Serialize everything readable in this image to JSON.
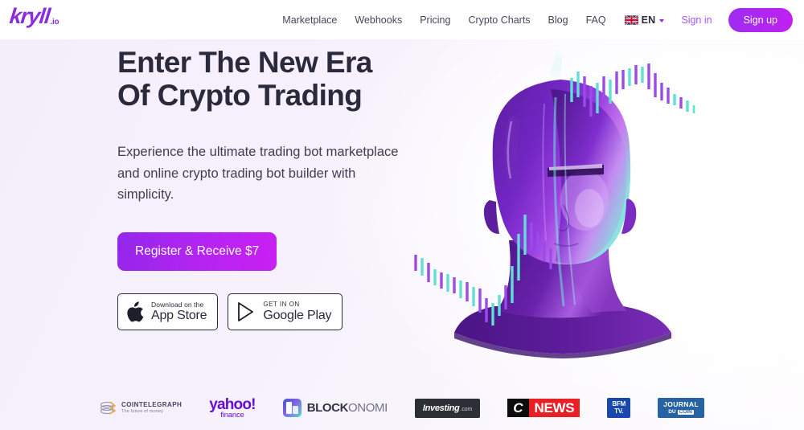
{
  "brand": {
    "logo_main": "kryll",
    "logo_suffix": ".io",
    "accent_purple": "#8a2be2",
    "accent_magenta": "#c31ff0"
  },
  "header": {
    "nav_items": [
      {
        "label": "Marketplace",
        "name": "nav-marketplace"
      },
      {
        "label": "Webhooks",
        "name": "nav-webhooks"
      },
      {
        "label": "Pricing",
        "name": "nav-pricing"
      },
      {
        "label": "Crypto Charts",
        "name": "nav-crypto-charts"
      },
      {
        "label": "Blog",
        "name": "nav-blog"
      },
      {
        "label": "FAQ",
        "name": "nav-faq"
      }
    ],
    "language": {
      "label": "EN",
      "flag": "uk-flag-icon",
      "caret": "chevron-down-icon"
    },
    "sign_in_label": "Sign in",
    "sign_up_label": "Sign up"
  },
  "hero": {
    "headline": "Enter The New Era Of Crypto Trading",
    "subtitle": "Experience the ultimate trading bot marketplace and online crypto trading bot builder with simplicity.",
    "cta_label": "Register & Receive $7",
    "headline_color": "#2b2a3d",
    "background_color": "#f6f1fc",
    "app_store": {
      "top": "Download on the",
      "bottom": "App Store",
      "icon": "apple-icon"
    },
    "google_play": {
      "top": "GET IN ON",
      "bottom": "Google Play",
      "icon": "google-play-icon"
    },
    "illustration": {
      "name": "crypto-ai-head-illustration",
      "description": "Purple 3D android head with candlestick charts"
    }
  },
  "press": [
    {
      "name": "cointelegraph",
      "title": "COINTELEGRAPH",
      "tagline": "The future of money"
    },
    {
      "name": "yahoo-finance",
      "title": "yahoo!",
      "tagline": "finance"
    },
    {
      "name": "blockonomi",
      "title_bold": "BLOCK",
      "title_light": "ONOMI"
    },
    {
      "name": "investing-com",
      "title": "Investing",
      "suffix": ".com"
    },
    {
      "name": "cnews",
      "letter": "C",
      "title": "NEWS"
    },
    {
      "name": "bfm-tv",
      "line1": "BFM",
      "line2": "TV."
    },
    {
      "name": "journal-du-coin",
      "line1": "JOURNAL",
      "line2_a": "DU",
      "line2_b": "COIN"
    }
  ]
}
